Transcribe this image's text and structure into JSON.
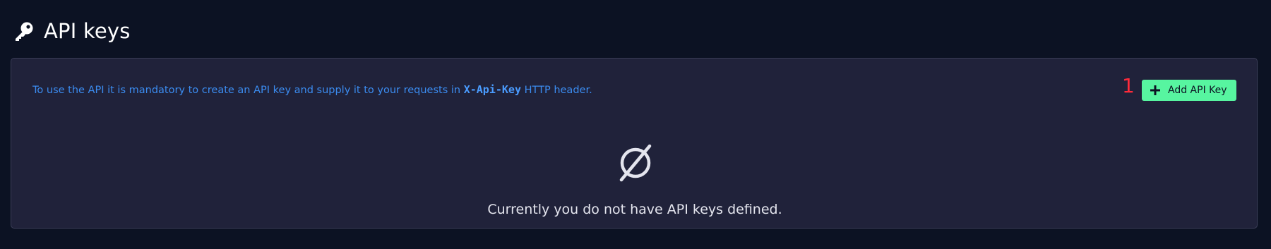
{
  "header": {
    "icon": "key-icon",
    "title": "API keys"
  },
  "card": {
    "info_prefix": "To use the API it is mandatory to create an API key and supply it to your requests in ",
    "info_code": "X-Api-Key",
    "info_suffix": " HTTP header.",
    "annotation_number": "1",
    "add_button_label": "Add API Key",
    "add_button_icon": "plus-icon",
    "empty_icon": "empty-set-icon",
    "empty_message": "Currently you do not have API keys defined."
  },
  "colors": {
    "background": "#0c1223",
    "card_background": "#20223a",
    "info_text": "#3b8cf0",
    "button_background": "#57f5a0",
    "annotation": "#ff2b3a"
  }
}
